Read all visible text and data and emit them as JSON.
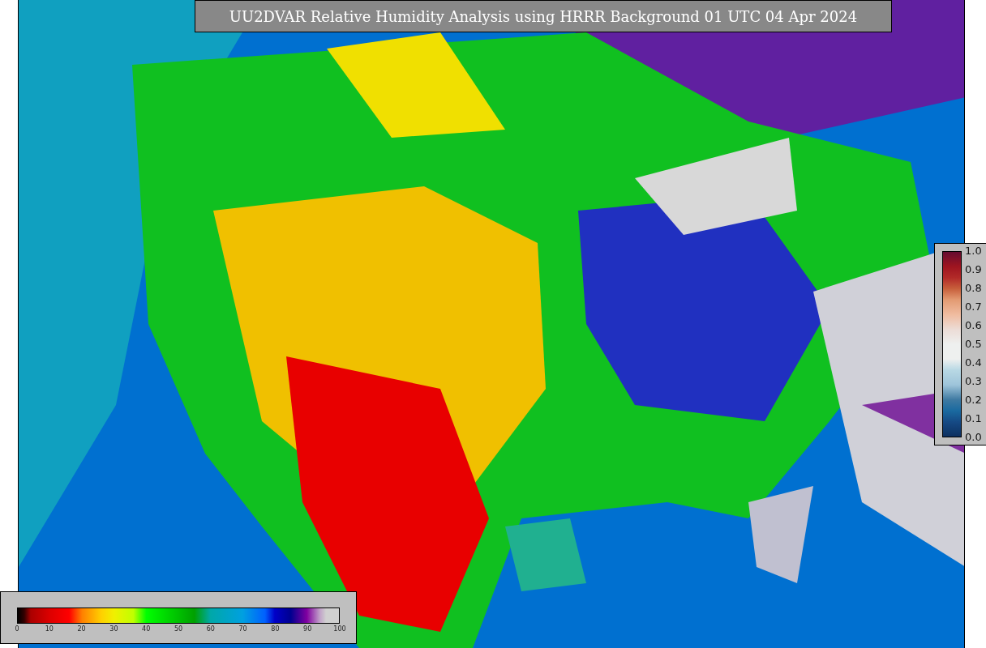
{
  "title": "UU2DVAR Relative Humidity Analysis using HRRR Background 01 UTC 04 Apr 2024",
  "bottom_colorbar": {
    "ticks": [
      "0",
      "10",
      "20",
      "30",
      "40",
      "50",
      "60",
      "70",
      "80",
      "90",
      "100"
    ]
  },
  "side_colorbar": {
    "ticks": [
      "1.0",
      "0.9",
      "0.8",
      "0.7",
      "0.6",
      "0.5",
      "0.4",
      "0.3",
      "0.2",
      "0.1",
      "0.0"
    ]
  }
}
